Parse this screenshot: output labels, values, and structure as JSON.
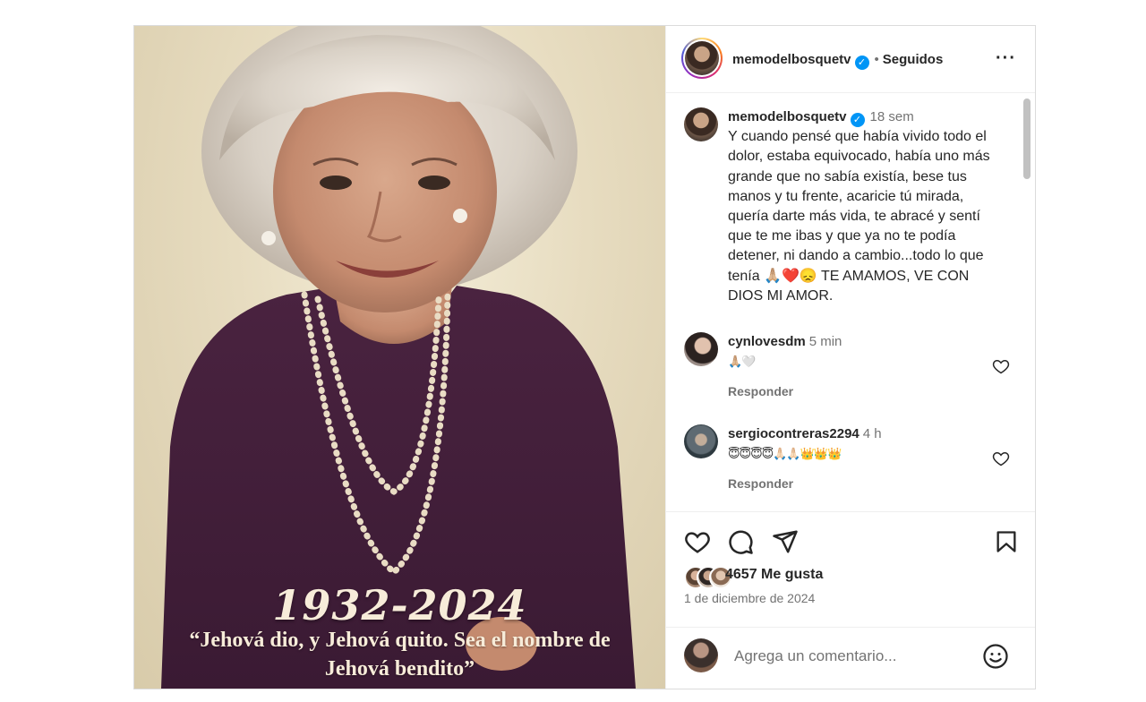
{
  "post": {
    "image": {
      "years": "1932-2024",
      "quote": "“Jehová dio, y Jehová quito. Sea el nombre de Jehová bendito”"
    },
    "header": {
      "username": "memodelbosquetv",
      "verified": true,
      "separator": "•",
      "follow_status": "Seguidos",
      "more_icon": "more-horizontal-icon"
    },
    "caption": {
      "username": "memodelbosquetv",
      "time": "18 sem",
      "text": "Y cuando pensé que había vivido todo el dolor, estaba equivocado, había uno más grande que no sabía existía, bese tus manos y tu frente, acaricie tú mirada, quería darte más vida, te abracé y sentí que te me ibas y que ya no te podía detener, ni dando a cambio...todo lo que tenía 🙏🏼❤️😞 TE AMAMOS, VE CON DIOS MI AMOR."
    },
    "comments": [
      {
        "username": "cynlovesdm",
        "time": "5 min",
        "text": "🙏🏼🤍",
        "reply_label": "Responder"
      },
      {
        "username": "sergiocontreras2294",
        "time": "4 h",
        "text": "😇😇😇😇🙏🏻🙏🏻👑👑👑",
        "reply_label": "Responder"
      }
    ],
    "actions": {
      "like_icon": "heart-icon",
      "comment_icon": "comment-icon",
      "share_icon": "send-icon",
      "save_icon": "bookmark-icon"
    },
    "likes_text": "4657 Me gusta",
    "date": "1 de diciembre de 2024",
    "add_comment": {
      "placeholder": "Agrega un comentario...",
      "emoji_icon": "smiley-icon"
    }
  }
}
